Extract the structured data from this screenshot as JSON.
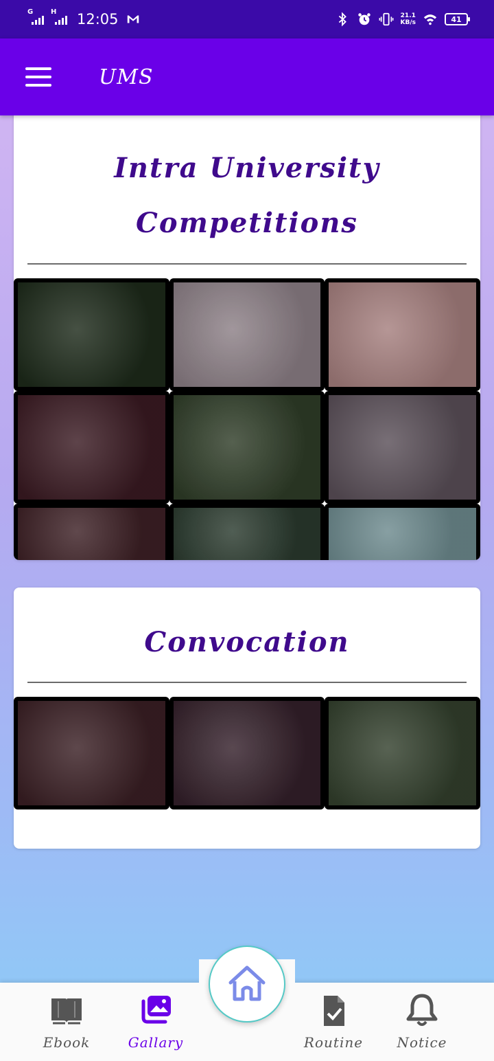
{
  "status_bar": {
    "time": "12:05",
    "net1": "G",
    "net2": "H",
    "speed_value": "21.1",
    "speed_unit": "KB/s",
    "battery": "41",
    "mail_icon": "gmail-icon"
  },
  "app_bar": {
    "title": "UMS"
  },
  "sections": [
    {
      "title": "Intra University Competitions",
      "photos": [
        {
          "color": "#1d2a1a"
        },
        {
          "color": "#8c7f86"
        },
        {
          "color": "#a57f7e"
        },
        {
          "color": "#3a1a22"
        },
        {
          "color": "#2f3d28"
        },
        {
          "color": "#5a4f58"
        },
        {
          "color": "#3d2025"
        },
        {
          "color": "#2a3a2e"
        },
        {
          "color": "#6d8a8e"
        }
      ]
    },
    {
      "title": "Convocation",
      "photos": [
        {
          "color": "#3a1f24"
        },
        {
          "color": "#34202a"
        },
        {
          "color": "#33402d"
        }
      ]
    }
  ],
  "bottom_nav": {
    "items": [
      {
        "label": "Ebook",
        "icon": "book-icon"
      },
      {
        "label": "Gallary",
        "icon": "gallery-icon"
      },
      {
        "label": "Routine",
        "icon": "clipboard-check-icon"
      },
      {
        "label": "Notice",
        "icon": "bell-icon"
      }
    ],
    "center": {
      "icon": "home-icon"
    },
    "active_index": 1
  },
  "colors": {
    "status_bar": "#3b0aa8",
    "app_bar": "#6a00e8",
    "title": "#3f0a8c",
    "accent": "#6a00e8"
  }
}
